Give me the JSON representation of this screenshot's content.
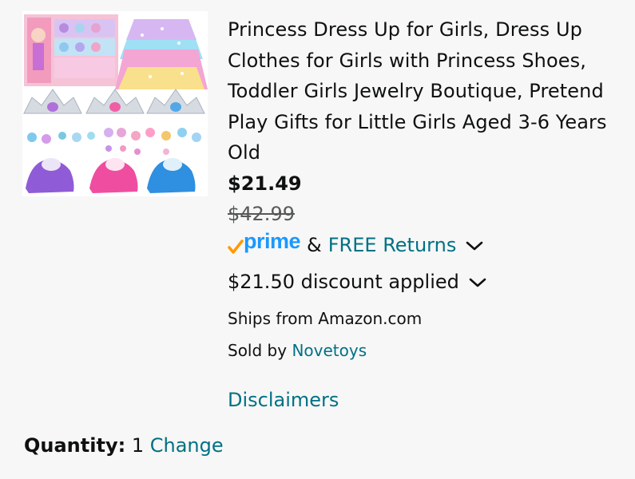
{
  "product": {
    "image_alt": "Princess dress up set: shoes, tutu skirts, tiaras and jewelry",
    "title": "Princess Dress Up for Girls, Dress Up Clothes for Girls with Princess Shoes, Toddler Girls Jewelry Boutique, Pretend Play Gifts for Little Girls Aged 3-6 Years Old",
    "price": "$21.49",
    "list_price": "$42.99",
    "prime_label": "prime",
    "ampersand": "&",
    "free_returns": "FREE Returns",
    "discount": "$21.50 discount applied",
    "ships_from": "Ships from Amazon.com",
    "sold_by_label": "Sold by",
    "seller": "Novetoys",
    "disclaimers": "Disclaimers"
  },
  "quantity": {
    "label": "Quantity:",
    "value": "1",
    "change": "Change"
  },
  "colors": {
    "link": "#007185",
    "prime_blue": "#1a98ff",
    "prime_check": "#ff9900",
    "text": "#0f1111",
    "muted": "#565959"
  }
}
